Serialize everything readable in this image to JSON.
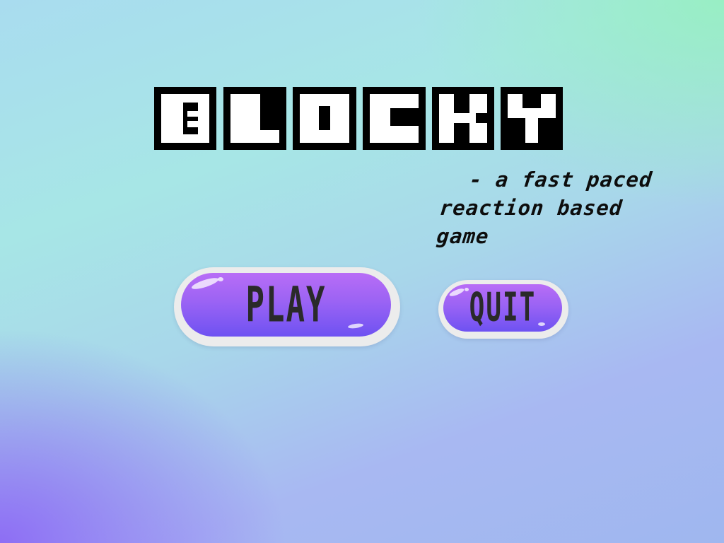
{
  "game": {
    "title": "BLOCKY",
    "subtitle_line1": "- a fast paced",
    "subtitle_line2": "reaction based game"
  },
  "menu": {
    "play_label": "PLAY",
    "quit_label": "QUIT"
  },
  "colors": {
    "background_top_right": "#a0f0c8",
    "background_bottom_left": "#8c69f5",
    "button_gradient_top": "#b86df6",
    "button_gradient_bottom": "#6e52f2",
    "button_border": "#ececec",
    "logo_ink": "#000000",
    "logo_paper": "#ffffff"
  }
}
